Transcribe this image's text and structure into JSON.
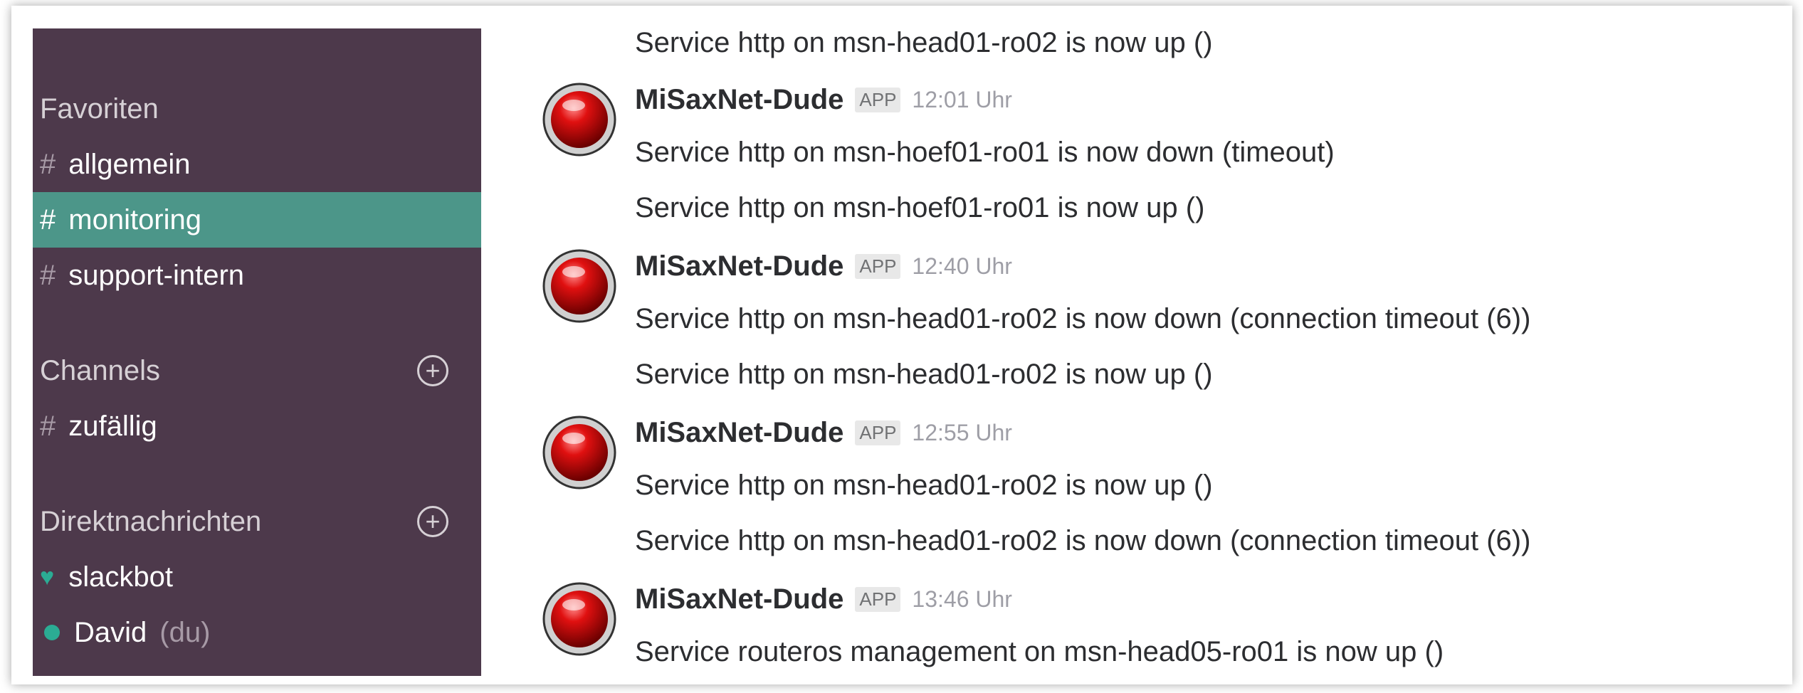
{
  "sidebar": {
    "favorites_heading": "Favoriten",
    "favorites": [
      {
        "hash": "#",
        "name": "allgemein"
      },
      {
        "hash": "#",
        "name": "monitoring"
      },
      {
        "hash": "#",
        "name": "support-intern"
      }
    ],
    "channels_heading": "Channels",
    "channels": [
      {
        "hash": "#",
        "name": "zufällig"
      }
    ],
    "dm_heading": "Direktnachrichten",
    "dms": [
      {
        "name": "slackbot"
      },
      {
        "name": "David",
        "suffix": "(du)"
      }
    ],
    "plus_symbol": "+",
    "heart_symbol": "♥",
    "active_channel": "monitoring",
    "colors": {
      "sidebar_bg": "#4d394b",
      "active_bg": "#4c9689",
      "presence": "#2bac94"
    }
  },
  "messages": {
    "lines": [
      "Service http on msn-head01-ro02 is now up ()",
      "Service http on msn-hoef01-ro01 is now down (timeout)",
      "Service http on msn-hoef01-ro01 is now up ()",
      "Service http on msn-head01-ro02 is now down (connection timeout (6))",
      "Service http on msn-head01-ro02 is now up ()",
      "Service http on msn-head01-ro02 is now up ()",
      "Service http on msn-head01-ro02 is now down (connection timeout (6))",
      "Service routeros management on msn-head05-ro01 is now up ()"
    ],
    "groups": [
      {
        "author": "MiSaxNet-Dude",
        "badge": "APP",
        "time": "12:01 Uhr"
      },
      {
        "author": "MiSaxNet-Dude",
        "badge": "APP",
        "time": "12:40 Uhr"
      },
      {
        "author": "MiSaxNet-Dude",
        "badge": "APP",
        "time": "12:55 Uhr"
      },
      {
        "author": "MiSaxNet-Dude",
        "badge": "APP",
        "time": "13:46 Uhr"
      }
    ],
    "avatar_icon": "red-ball-icon"
  }
}
